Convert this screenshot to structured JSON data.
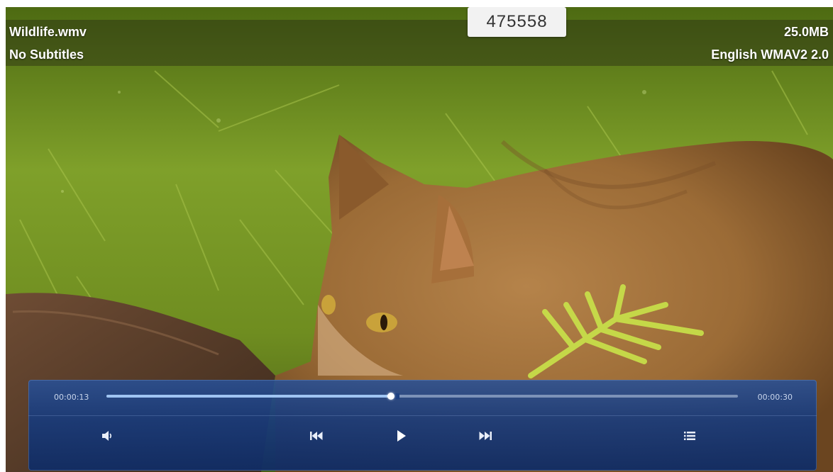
{
  "video": {
    "file_name": "Wildlife.wmv",
    "subtitles": "No Subtitles",
    "file_size": "25.0MB",
    "audio_track": "English WMAV2 2.0",
    "frame_counter": "475558"
  },
  "controls": {
    "current_time": "00:00:13",
    "total_time": "00:00:30",
    "progress": 0.45,
    "buttons": [
      "volume-icon",
      "previous-icon",
      "play-icon",
      "next-icon",
      "playlist-icon"
    ]
  },
  "colors": {
    "panel": "#1e3f80",
    "seek_fill": "#9fc4f2",
    "text": "#ffffff"
  }
}
